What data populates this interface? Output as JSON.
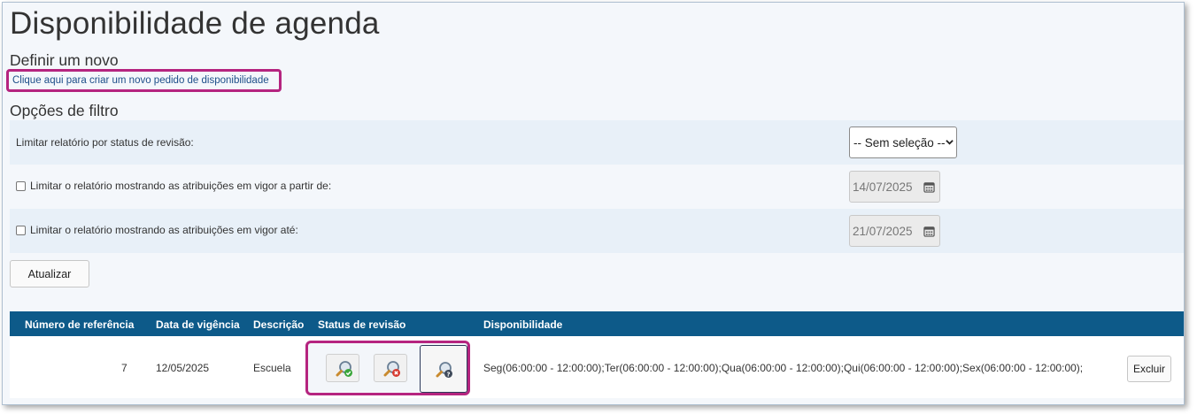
{
  "page": {
    "title": "Disponibilidade de agenda"
  },
  "new_section": {
    "heading": "Definir um novo",
    "link_text": "Clique aqui para criar um novo pedido de disponibilidade"
  },
  "filter_section": {
    "heading": "Opções de filtro",
    "status_label": "Limitar relatório por status de revisão:",
    "status_selected": "-- Sem seleção --",
    "from_label": "Limitar o relatório mostrando as atribuições em vigor a partir de:",
    "from_date": "14/07/2025",
    "to_label": "Limitar o relatório mostrando as atribuições em vigor até:",
    "to_date": "21/07/2025",
    "refresh_label": "Atualizar"
  },
  "table": {
    "columns": [
      "Número de referência",
      "Data de vigência",
      "Descrição",
      "Status de revisão",
      "Disponibilidade"
    ],
    "rows": [
      {
        "ref": "7",
        "date": "12/05/2025",
        "description": "Escuela",
        "availability": "Seg(06:00:00 - 12:00:00);Ter(06:00:00 - 12:00:00);Qua(06:00:00 - 12:00:00);Qui(06:00:00 - 12:00:00);Sex(06:00:00 - 12:00:00);",
        "status_icons": [
          "magnifier-approve-icon",
          "magnifier-reject-icon",
          "magnifier-pending-icon"
        ],
        "delete_label": "Excluir"
      }
    ]
  },
  "colors": {
    "header_bg": "#0d5a89",
    "highlight": "#b5247f",
    "link": "#1d4e89",
    "row_shade": "#e8f0f8"
  }
}
